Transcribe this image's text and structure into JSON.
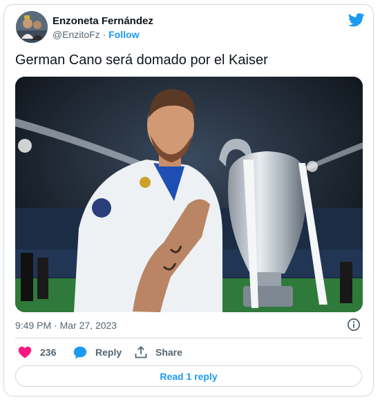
{
  "author": {
    "display_name": "Enzoneta Fernández",
    "handle": "@EnzitoFz",
    "separator": "·",
    "follow_label": "Follow"
  },
  "tweet": {
    "text": "German Cano será domado por el Kaiser",
    "time": "9:49 PM",
    "separator": "·",
    "date": "Mar 27, 2023"
  },
  "media": {
    "kind": "photo",
    "icon": "photo-player-trophy"
  },
  "actions": {
    "likes_count": "236",
    "reply_label": "Reply",
    "share_label": "Share"
  },
  "footer": {
    "read_replies_label": "Read 1 reply"
  },
  "colors": {
    "accent": "#1d9bf0",
    "like": "#f91880",
    "muted": "#536471",
    "border": "#cfd9de",
    "text": "#0f1419"
  }
}
